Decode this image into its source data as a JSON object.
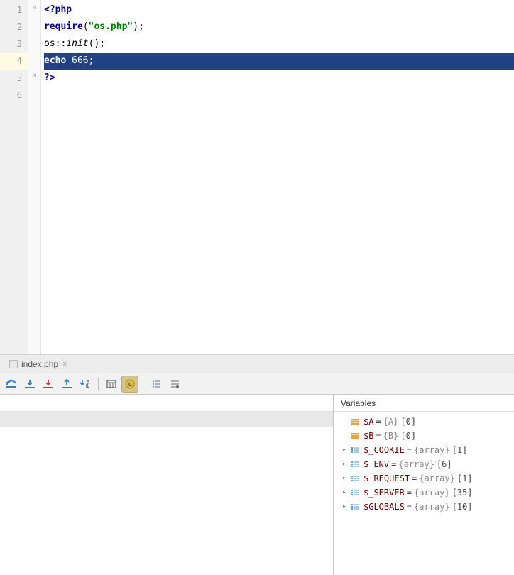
{
  "editor": {
    "lines": [
      {
        "num": "1",
        "type": "code"
      },
      {
        "num": "2",
        "type": "code"
      },
      {
        "num": "3",
        "type": "code"
      },
      {
        "num": "4",
        "type": "highlighted"
      },
      {
        "num": "5",
        "type": "code"
      },
      {
        "num": "6",
        "type": "empty"
      }
    ],
    "code": {
      "l1_open": "<?php",
      "l2_kw": "require",
      "l2_p1": "(",
      "l2_str": "\"os.php\"",
      "l2_p2": ");",
      "l3_cls": "os",
      "l3_sep": "::",
      "l3_fn": "init",
      "l3_p": "();",
      "l4_kw": "echo",
      "l4_sp": " ",
      "l4_num": "666",
      "l4_semi": ";",
      "l5_close": "?>"
    }
  },
  "tab": {
    "filename": "index.php"
  },
  "toolbar": {
    "buttons": [
      "rerun",
      "step-into",
      "step-out",
      "step-into-my",
      "run-to-cursor",
      "evaluate",
      "console",
      "watches",
      "mute"
    ]
  },
  "variables": {
    "title": "Variables",
    "items": [
      {
        "expand": false,
        "icon": "field",
        "name": "$A",
        "type": "{A}",
        "size": "[0]"
      },
      {
        "expand": false,
        "icon": "field",
        "name": "$B",
        "type": "{B}",
        "size": "[0]"
      },
      {
        "expand": true,
        "icon": "array",
        "name": "$_COOKIE",
        "type": "{array}",
        "size": "[1]"
      },
      {
        "expand": true,
        "icon": "array",
        "name": "$_ENV",
        "type": "{array}",
        "size": "[6]"
      },
      {
        "expand": true,
        "icon": "array",
        "name": "$_REQUEST",
        "type": "{array}",
        "size": "[1]"
      },
      {
        "expand": true,
        "icon": "array",
        "name": "$_SERVER",
        "type": "{array}",
        "size": "[35]"
      },
      {
        "expand": true,
        "icon": "array",
        "name": "$GLOBALS",
        "type": "{array}",
        "size": "[10]"
      }
    ]
  }
}
